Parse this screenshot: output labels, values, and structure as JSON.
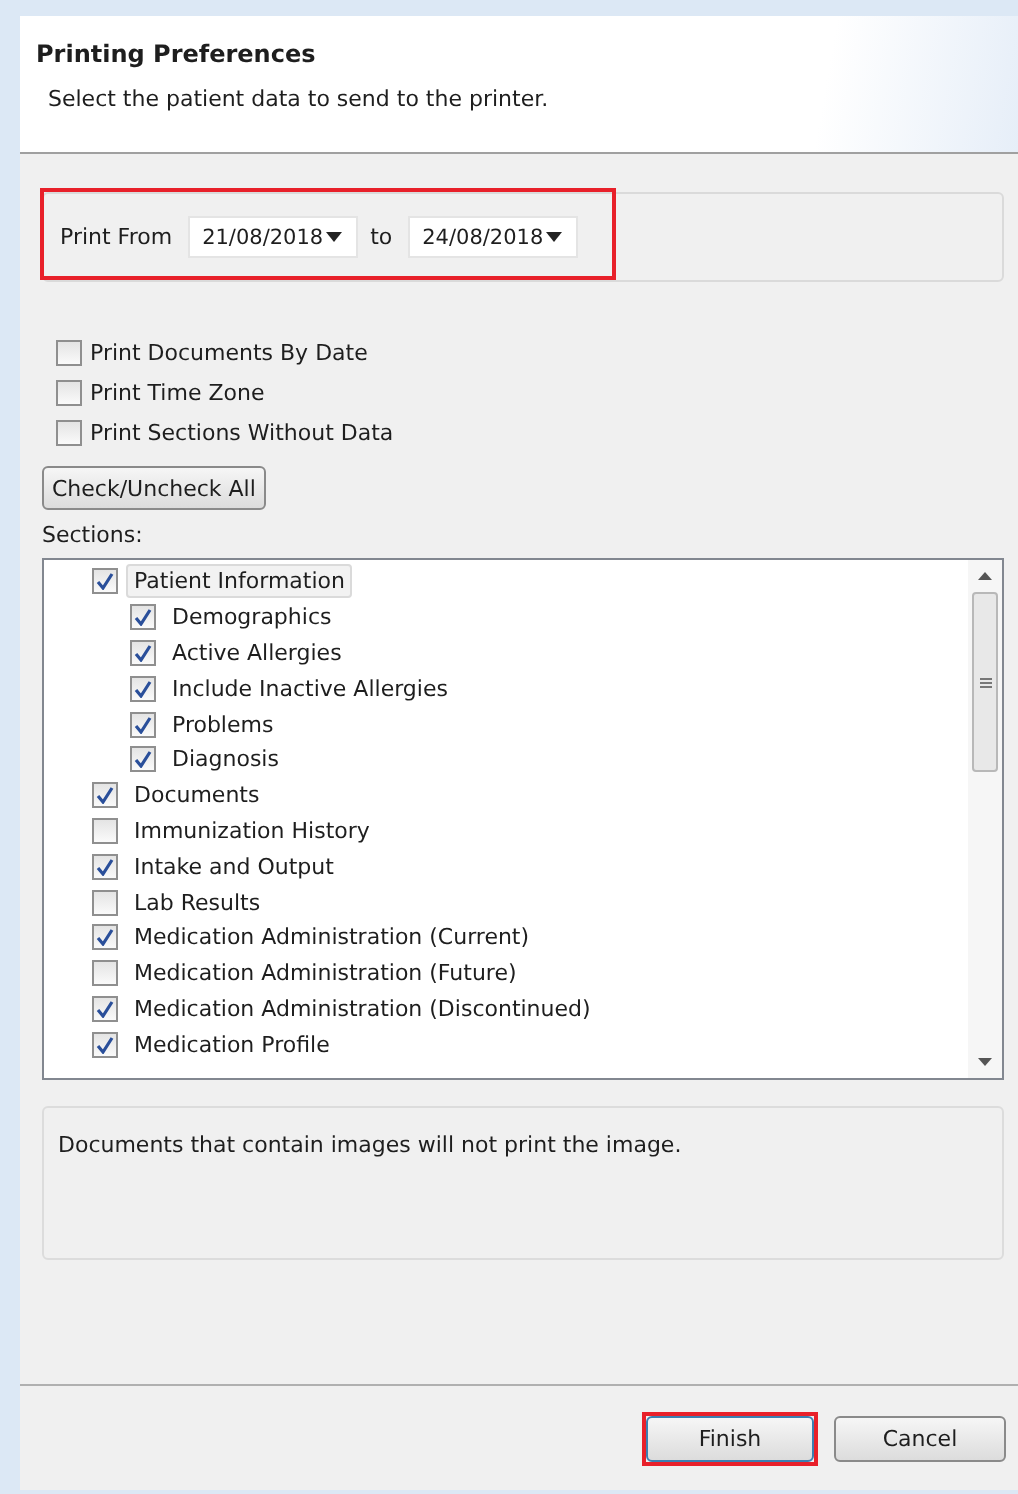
{
  "header": {
    "title": "Printing Preferences",
    "subtitle": "Select the patient data to send to the printer."
  },
  "date_range": {
    "label": "Print From",
    "from": "21/08/2018",
    "separator": "to",
    "to": "24/08/2018"
  },
  "options": [
    {
      "label": "Print Documents By Date",
      "checked": false
    },
    {
      "label": "Print Time Zone",
      "checked": false
    },
    {
      "label": "Print Sections Without Data",
      "checked": false
    }
  ],
  "check_all_button": "Check/Uncheck All",
  "sections_label": "Sections:",
  "sections": [
    {
      "label": "Patient Information",
      "checked": true,
      "selected": true,
      "children": [
        {
          "label": "Demographics",
          "checked": true,
          "selected": false
        },
        {
          "label": "Active Allergies",
          "checked": true,
          "selected": false
        },
        {
          "label": "Include Inactive Allergies",
          "checked": true,
          "selected": false
        },
        {
          "label": "Problems",
          "checked": true,
          "selected": false
        },
        {
          "label": "Diagnosis",
          "checked": true,
          "selected": false
        }
      ]
    },
    {
      "label": "Documents",
      "checked": true,
      "selected": false
    },
    {
      "label": "Immunization History",
      "checked": false,
      "selected": false
    },
    {
      "label": "Intake and Output",
      "checked": true,
      "selected": false
    },
    {
      "label": "Lab Results",
      "checked": false,
      "selected": false
    },
    {
      "label": "Medication Administration (Current)",
      "checked": true,
      "selected": false
    },
    {
      "label": "Medication Administration (Future)",
      "checked": false,
      "selected": false
    },
    {
      "label": "Medication Administration (Discontinued)",
      "checked": true,
      "selected": false
    },
    {
      "label": "Medication Profile",
      "checked": true,
      "selected": false
    }
  ],
  "note": "Documents that contain images will not print the image.",
  "buttons": [
    {
      "label": "Finish",
      "kind": "primary"
    },
    {
      "label": "Cancel",
      "kind": "normal"
    }
  ]
}
